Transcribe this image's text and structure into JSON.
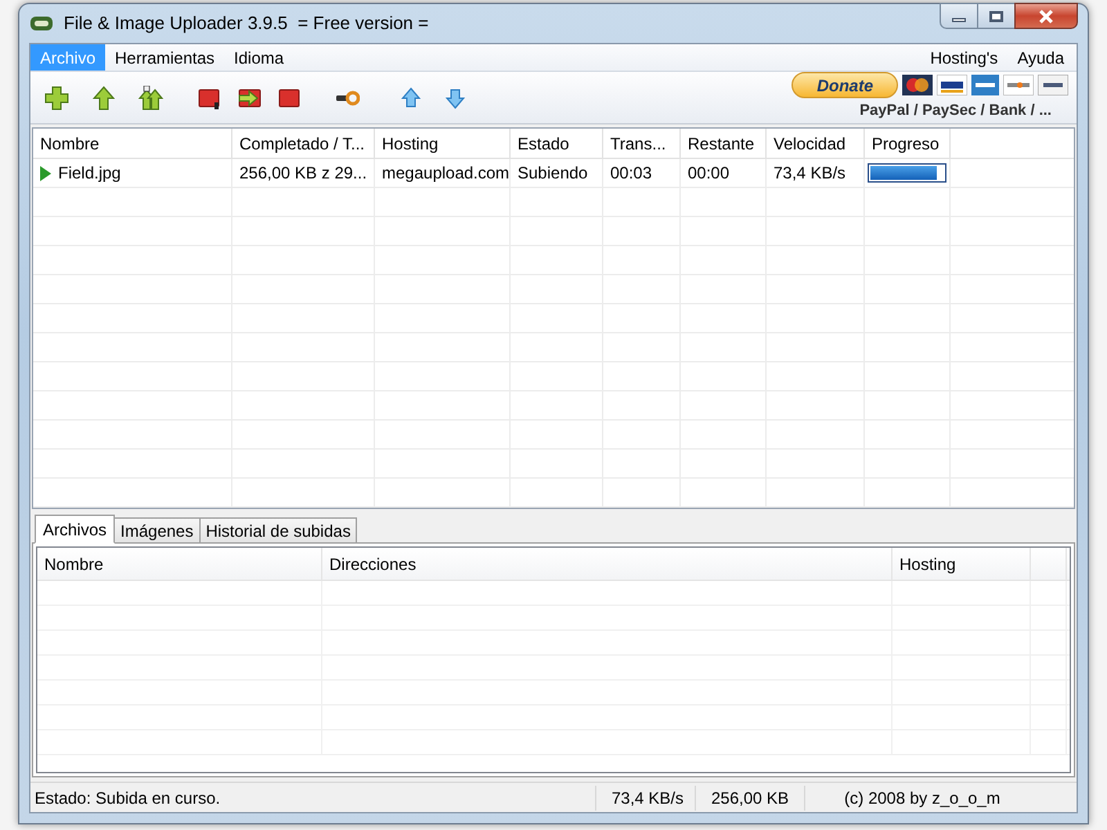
{
  "window": {
    "title": "File & Image Uploader 3.9.5  = Free version ="
  },
  "menu_left": [
    {
      "label": "Archivo",
      "selected": true
    },
    {
      "label": "Herramientas",
      "selected": false
    },
    {
      "label": "Idioma",
      "selected": false
    }
  ],
  "menu_right": [
    {
      "label": "Hosting's",
      "selected": false
    },
    {
      "label": "Ayuda",
      "selected": false
    }
  ],
  "toolbar": [
    {
      "kind": "add"
    },
    {
      "kind": "up"
    },
    {
      "kind": "up-all"
    },
    {
      "kind": "stop-one"
    },
    {
      "kind": "skip"
    },
    {
      "kind": "stop"
    },
    {
      "kind": "key"
    },
    {
      "kind": "move-up"
    },
    {
      "kind": "move-down"
    }
  ],
  "donate": {
    "button": "Donate",
    "methods": "PayPal / PaySec / Bank / ..."
  },
  "uploads": {
    "columns": [
      "Nombre",
      "Completado / T...",
      "Hosting",
      "Estado",
      "Trans...",
      "Restante",
      "Velocidad",
      "Progreso"
    ],
    "rows": [
      {
        "name": "Field.jpg",
        "completed": "256,00 KB z 29...",
        "hosting": "megaupload.com",
        "state": "Subiendo",
        "elapsed": "00:03",
        "remaining": "00:00",
        "speed": "73,4 KB/s",
        "level": 0.9,
        "active": true
      }
    ]
  },
  "tabs": [
    {
      "label": "Archivos",
      "selected": true
    },
    {
      "label": "Imágenes",
      "selected": false
    },
    {
      "label": "Historial de subidas",
      "selected": false
    }
  ],
  "links": {
    "columns": [
      "Nombre",
      "Direcciones",
      "Hosting"
    ]
  },
  "status_bar": {
    "state": "Estado: Subida en curso.",
    "speed": "73,4 KB/s",
    "size": "256,00 KB",
    "copyright": "(c) 2008 by z_o_o_m"
  }
}
